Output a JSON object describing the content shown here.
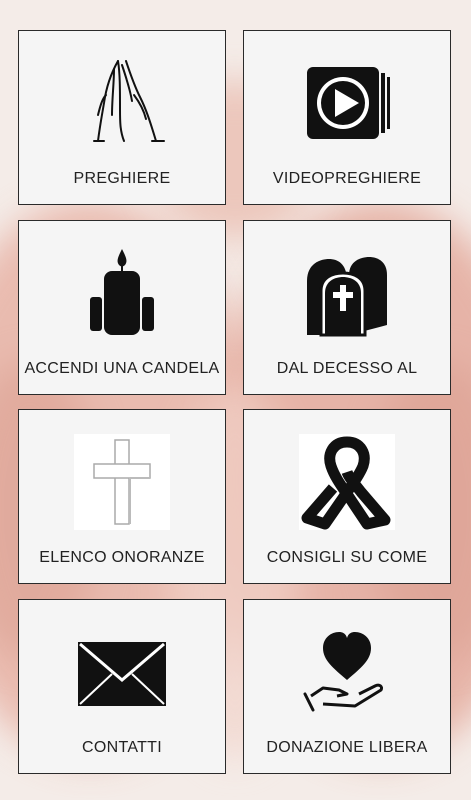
{
  "tiles": [
    {
      "label": "PREGHIERE",
      "icon": "praying-hands-icon"
    },
    {
      "label": "VIDEOPREGHIERE",
      "icon": "video-play-icon"
    },
    {
      "label": "ACCENDI UNA CANDELA",
      "icon": "candle-icon"
    },
    {
      "label": "DAL DECESSO AL",
      "icon": "tombstone-icon"
    },
    {
      "label": "ELENCO ONORANZE",
      "icon": "cross-icon"
    },
    {
      "label": "CONSIGLI SU COME",
      "icon": "mourning-ribbon-icon"
    },
    {
      "label": "CONTATTI",
      "icon": "envelope-icon"
    },
    {
      "label": "DONAZIONE LIBERA",
      "icon": "heart-in-hand-icon"
    }
  ]
}
